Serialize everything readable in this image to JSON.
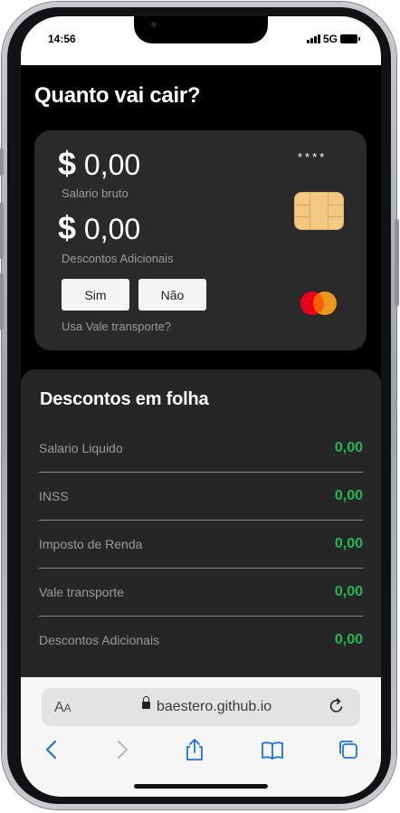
{
  "status_bar": {
    "time": "14:56",
    "network": "5G"
  },
  "app": {
    "title": "Quanto vai cair?",
    "card": {
      "gross_salary": {
        "currency": "$",
        "value": "0,00",
        "label": "Salario bruto"
      },
      "extra_discounts": {
        "currency": "$",
        "value": "0,00",
        "label": "Descontos Adicionais"
      },
      "card_number_mask": "****",
      "yes_button": "Sim",
      "no_button": "Não",
      "transport_question": "Usa Vale transporte?"
    },
    "discounts": {
      "title": "Descontos em folha",
      "rows": [
        {
          "label": "Salario Liquido",
          "value": "0,00"
        },
        {
          "label": "INSS",
          "value": "0,00"
        },
        {
          "label": "Imposto de Renda",
          "value": "0,00"
        },
        {
          "label": "Vale transporte",
          "value": "0,00"
        },
        {
          "label": "Descontos Adicionais",
          "value": "0,00"
        }
      ]
    }
  },
  "browser": {
    "text_size_label": "AA",
    "url": "baestero.github.io",
    "toolbar": [
      "back-icon",
      "forward-icon",
      "share-icon",
      "bookmarks-icon",
      "tabs-icon"
    ]
  },
  "colors": {
    "accent_green": "#1db954",
    "bar_green": "#1aaf4c",
    "card_bg": "#2a2a2a",
    "panel_bg": "#262626"
  }
}
